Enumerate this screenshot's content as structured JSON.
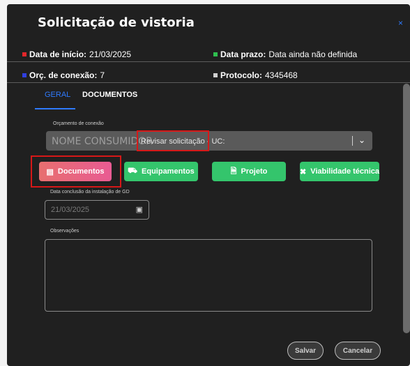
{
  "dialog": {
    "title": "Solicitação de vistoria",
    "close_glyph": "×"
  },
  "info": {
    "start_label": "Data de início:",
    "start_value": "21/03/2025",
    "deadline_label": "Data prazo:",
    "deadline_value": "Data ainda não definida",
    "budget_label": "Orç. de conexão:",
    "budget_value": "7",
    "protocol_label": "Protocolo:",
    "protocol_value": "4345468",
    "colors": {
      "start": "#e3262a",
      "deadline": "#2fbf4f",
      "budget": "#2f3fe0",
      "protocol": "#d0d0d0"
    }
  },
  "tabs": [
    {
      "label": "GERAL",
      "active": true
    },
    {
      "label": "DOCUMENTOS",
      "active": false
    }
  ],
  "connection_select": {
    "label": "Orçamento de conexão",
    "consumer": "NOME CONSUMIDOR",
    "text": "Revisar solicitação - UC:",
    "icon": "chevron-down-icon"
  },
  "action_buttons": {
    "documents": "Documentos",
    "equipment": "Equipamentos",
    "project": "Projeto",
    "feasibility": "Viabilidade técnica"
  },
  "completion_date": {
    "label": "Data conclusão da instalação de GD",
    "value": "21/03/2025",
    "icon": "calendar-icon"
  },
  "observations": {
    "label": "Observações",
    "value": ""
  },
  "footer": {
    "save": "Salvar",
    "cancel": "Cancelar"
  }
}
